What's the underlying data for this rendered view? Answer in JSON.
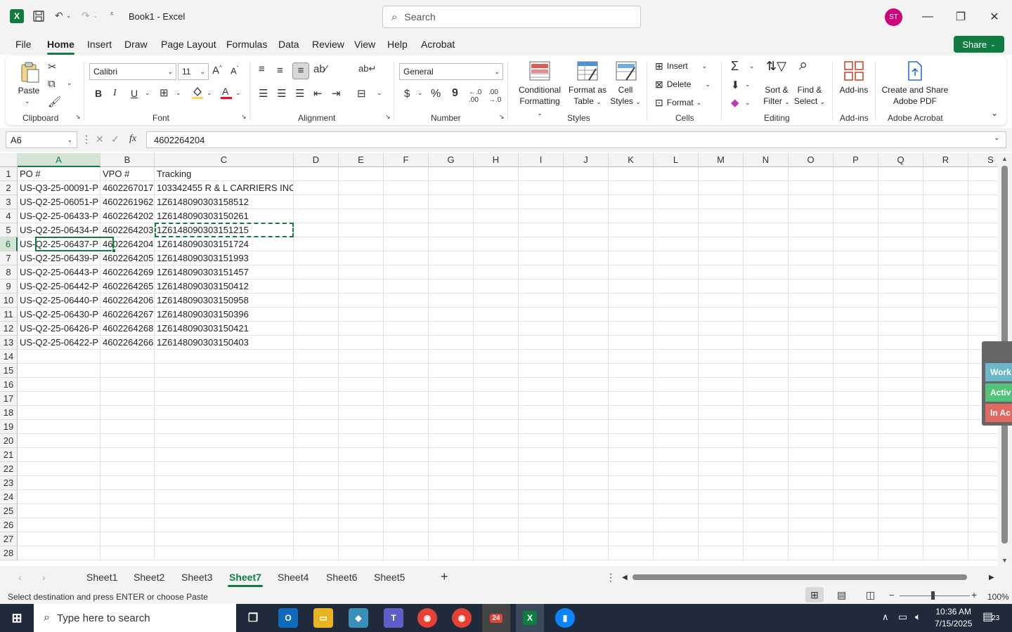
{
  "window": {
    "title": "Book1  -  Excel",
    "search_placeholder": "Search",
    "avatar_initials": "ST",
    "share_label": "Share"
  },
  "ribbon_tabs": [
    "File",
    "Home",
    "Insert",
    "Draw",
    "Page Layout",
    "Formulas",
    "Data",
    "Review",
    "View",
    "Help",
    "Acrobat"
  ],
  "ribbon": {
    "clipboard": {
      "paste": "Paste",
      "label": "Clipboard"
    },
    "font": {
      "name": "Calibri",
      "size": "11",
      "label": "Font",
      "bold": "B",
      "italic": "I",
      "underline": "U"
    },
    "alignment": {
      "label": "Alignment"
    },
    "number": {
      "format": "General",
      "label": "Number",
      "currency": "$",
      "percent": "%",
      "comma": "9"
    },
    "styles": {
      "conditional1": "Conditional",
      "conditional2": "Formatting",
      "table1": "Format as",
      "table2": "Table",
      "cell1": "Cell",
      "cell2": "Styles",
      "label": "Styles"
    },
    "cells": {
      "insert": "Insert",
      "delete": "Delete",
      "format": "Format",
      "label": "Cells"
    },
    "editing": {
      "sort1": "Sort &",
      "sort2": "Filter",
      "find1": "Find &",
      "find2": "Select",
      "label": "Editing"
    },
    "addins": {
      "btn": "Add-ins",
      "label": "Add-ins"
    },
    "acrobat": {
      "btn1": "Create and Share",
      "btn2": "Adobe PDF",
      "label": "Adobe Acrobat"
    }
  },
  "formula_bar": {
    "name_box": "A6",
    "fx": "fx",
    "value": "4602264204"
  },
  "columns": [
    "A",
    "B",
    "C",
    "D",
    "E",
    "F",
    "G",
    "H",
    "I",
    "J",
    "K",
    "L",
    "M",
    "N",
    "O",
    "P",
    "Q",
    "R",
    "S"
  ],
  "rows": [
    [
      "PO #",
      "VPO #",
      "Tracking"
    ],
    [
      "US-Q3-25-00091-P",
      "4602267017",
      "103342455 R & L CARRIERS INC."
    ],
    [
      "US-Q2-25-06051-P",
      "4602261962",
      "1Z6148090303158512"
    ],
    [
      "US-Q2-25-06433-P",
      "4602264202",
      "1Z6148090303150261"
    ],
    [
      "US-Q2-25-06434-P",
      "4602264203",
      "1Z6148090303151215"
    ],
    [
      "US-Q2-25-06437-P",
      "4602264204",
      "1Z6148090303151724"
    ],
    [
      "US-Q2-25-06439-P",
      "4602264205",
      "1Z6148090303151993"
    ],
    [
      "US-Q2-25-06443-P",
      "4602264269",
      "1Z6148090303151457"
    ],
    [
      "US-Q2-25-06442-P",
      "4602264265",
      "1Z6148090303150412"
    ],
    [
      "US-Q2-25-06440-P",
      "4602264206",
      "1Z6148090303150958"
    ],
    [
      "US-Q2-25-06430-P",
      "4602264267",
      "1Z6148090303150396"
    ],
    [
      "US-Q2-25-06426-P",
      "4602264268",
      "1Z6148090303150421"
    ],
    [
      "US-Q2-25-06422-P",
      "4602264266",
      "1Z6148090303150403"
    ]
  ],
  "row_numbers": [
    "1",
    "2",
    "3",
    "4",
    "5",
    "6",
    "7",
    "8",
    "9",
    "10",
    "11",
    "12",
    "13",
    "14",
    "15",
    "16",
    "17",
    "18",
    "19",
    "20",
    "21",
    "22",
    "23",
    "24",
    "25",
    "26",
    "27",
    "28"
  ],
  "side_panel": {
    "item1": "Work",
    "item2": "Activ",
    "item3": "In Ac"
  },
  "sheet_tabs": [
    "Sheet1",
    "Sheet2",
    "Sheet3",
    "Sheet7",
    "Sheet4",
    "Sheet6",
    "Sheet5"
  ],
  "active_sheet": "Sheet7",
  "status": {
    "message": "Select destination and press ENTER or choose Paste",
    "zoom": "100%"
  },
  "taskbar": {
    "search_placeholder": "Type here to search",
    "time": "10:36 AM",
    "date": "7/15/2025",
    "notifications": "23",
    "zoom_badge": "24"
  },
  "colors": {
    "excel_green": "#107c41",
    "taskbar": "#1f2a3a",
    "avatar": "#d1007d"
  }
}
